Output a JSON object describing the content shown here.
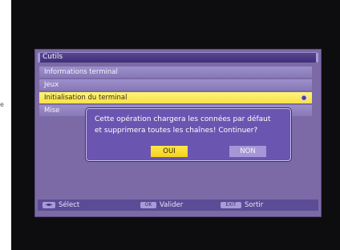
{
  "menu": {
    "title": "Cutils",
    "items": [
      {
        "label": "Informations terminal"
      },
      {
        "label": "Jeux"
      },
      {
        "label": "Initialisation du terminal"
      },
      {
        "label": "Mise"
      }
    ]
  },
  "dialog": {
    "line1": "Cette opération chargera les connées par défaut",
    "line2": "et supprimera toutes les chaînes! Continuer?",
    "yes_label": "OUI",
    "no_label": "NON"
  },
  "footer": {
    "select_key": "◄►",
    "select_label": "Sélect",
    "ok_key": "OK",
    "ok_label": "Valider",
    "exit_key": "EXIT",
    "exit_label": "Sortir"
  },
  "colors": {
    "background": "#7b6aa6",
    "menu_item": "#9d8fcb",
    "selected": "#f6e24a",
    "dialog": "#6a55b0",
    "footer": "#5c4b95"
  }
}
